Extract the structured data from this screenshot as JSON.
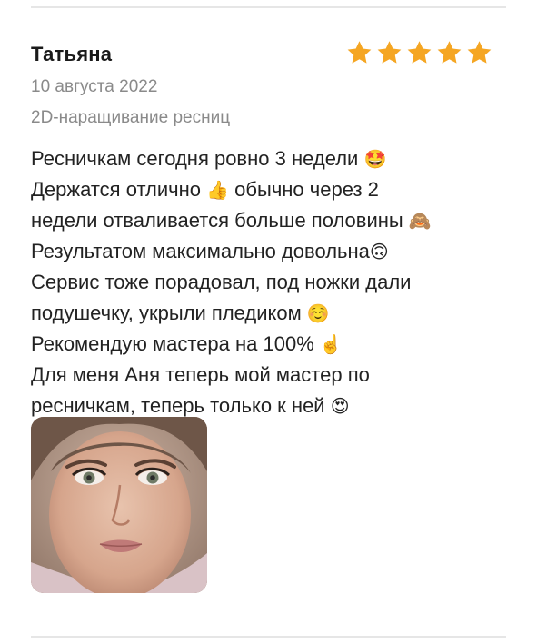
{
  "review": {
    "author": "Татьяна",
    "rating": 5,
    "rating_max": 5,
    "date": "10 августа 2022",
    "service": "2D-наращивание ресниц",
    "lines": [
      {
        "text": "Ресничкам сегодня ровно 3 недели",
        "emoji": "🤩"
      },
      {
        "text": "Держатся отлично",
        "emoji": "👍",
        "after": "обычно через 2"
      },
      {
        "text": "недели отваливается больше половины",
        "emoji": "🙈"
      },
      {
        "text": "Результатом максимально довольна",
        "emoji": "🙃"
      },
      {
        "text": "Сервис тоже порадовал, под ножки дали",
        "emoji": ""
      },
      {
        "text": "подушечку, укрыли пледиком",
        "emoji": "☺️"
      },
      {
        "text": "Рекомендую мастера на 100%",
        "emoji": "☝️"
      },
      {
        "text": "Для меня Аня теперь мой мастер по",
        "emoji": ""
      },
      {
        "text": "ресничкам, теперь только к ней",
        "emoji": "😍"
      }
    ],
    "photo": {
      "icon": "review-photo"
    }
  },
  "colors": {
    "star": "#F5A623",
    "muted": "#8a8a8a",
    "divider": "#e6e6e6"
  }
}
